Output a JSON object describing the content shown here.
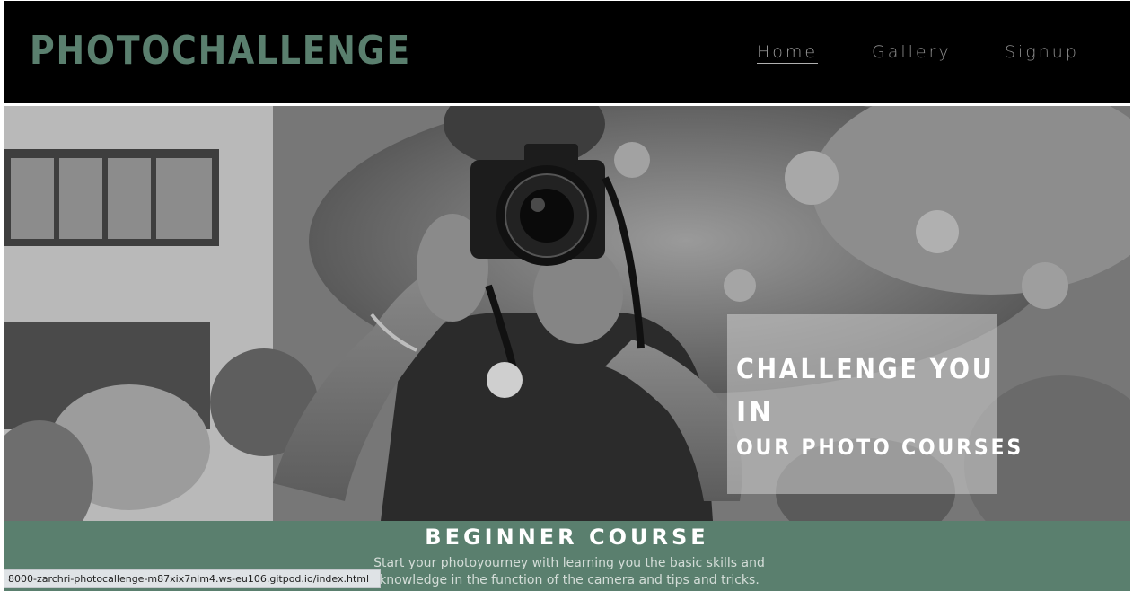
{
  "site": {
    "logo": "PHOTOCHALLENGE",
    "accent_color": "#5a7f6e"
  },
  "nav": {
    "items": [
      {
        "label": "Home",
        "active": true
      },
      {
        "label": "Gallery",
        "active": false
      },
      {
        "label": "Signup",
        "active": false
      }
    ]
  },
  "hero": {
    "image_icon": "photographer-with-camera-image",
    "line1": "CHALLENGE YOU",
    "line2": "IN",
    "line3": "OUR PHOTO COURSES"
  },
  "course": {
    "title": "BEGINNER COURSE",
    "description": "Start your photoyourney with learning you the basic skills and knowledge in the function of the camera and tips and tricks."
  },
  "statusbar": {
    "url": "8000-zarchri-photocallenge-m87xix7nlm4.ws-eu106.gitpod.io/index.html"
  }
}
